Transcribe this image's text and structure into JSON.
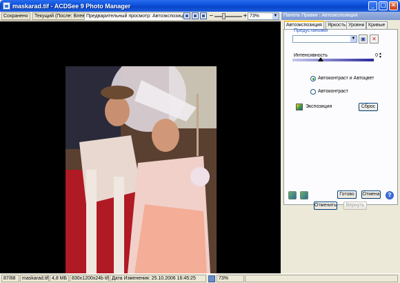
{
  "window": {
    "title": "maskarad.tif - ACDSee 9 Photo Manager",
    "controls": {
      "minimize": "_",
      "maximize": "□",
      "close": "✕"
    }
  },
  "toolbar": {
    "tabs": [
      "Сохранено",
      "Текущий (После: Влево)",
      "Предварительный просмотр: Автоэкспозиция"
    ],
    "zoom_minus": "−",
    "zoom_plus": "+",
    "zoom_value": "73%"
  },
  "viewer": {
    "image_description_icon": "photo-icon"
  },
  "panel": {
    "title": "Панель Правки : Автоэкспозиция",
    "tabs": [
      "Автоэкспозиция",
      "Яркость",
      "Уровни",
      "Кривые"
    ],
    "presets_label": "Предустановки",
    "intensity_label": "Интенсивность",
    "intensity_value": "0",
    "intensity_level": 0.35,
    "radio_autocontrast_color": "Автоконтраст и Автоцвет",
    "radio_autocontrast": "Автоконтраст",
    "exposure_label": "Экспозиция",
    "reset_button": "Сброс",
    "done_button": "Готово",
    "cancel_button": "Отмена",
    "undo_button": "Отменить",
    "redo_button": "Вернуть",
    "help_glyph": "?"
  },
  "statusbar": {
    "position": "87/88",
    "filename": "maskarad.tif",
    "size": "4,8 МБ",
    "dimensions": "830x1200x24b tiff",
    "date": "Дата Изменения: 25.10.2006 16:45:25",
    "zoom": "73%"
  },
  "colors": {
    "titlebar": "#0a4fd8",
    "viewer_bg": "#000000",
    "panel_bg": "#ece9d8",
    "accent_tab": "#ffc83c"
  }
}
